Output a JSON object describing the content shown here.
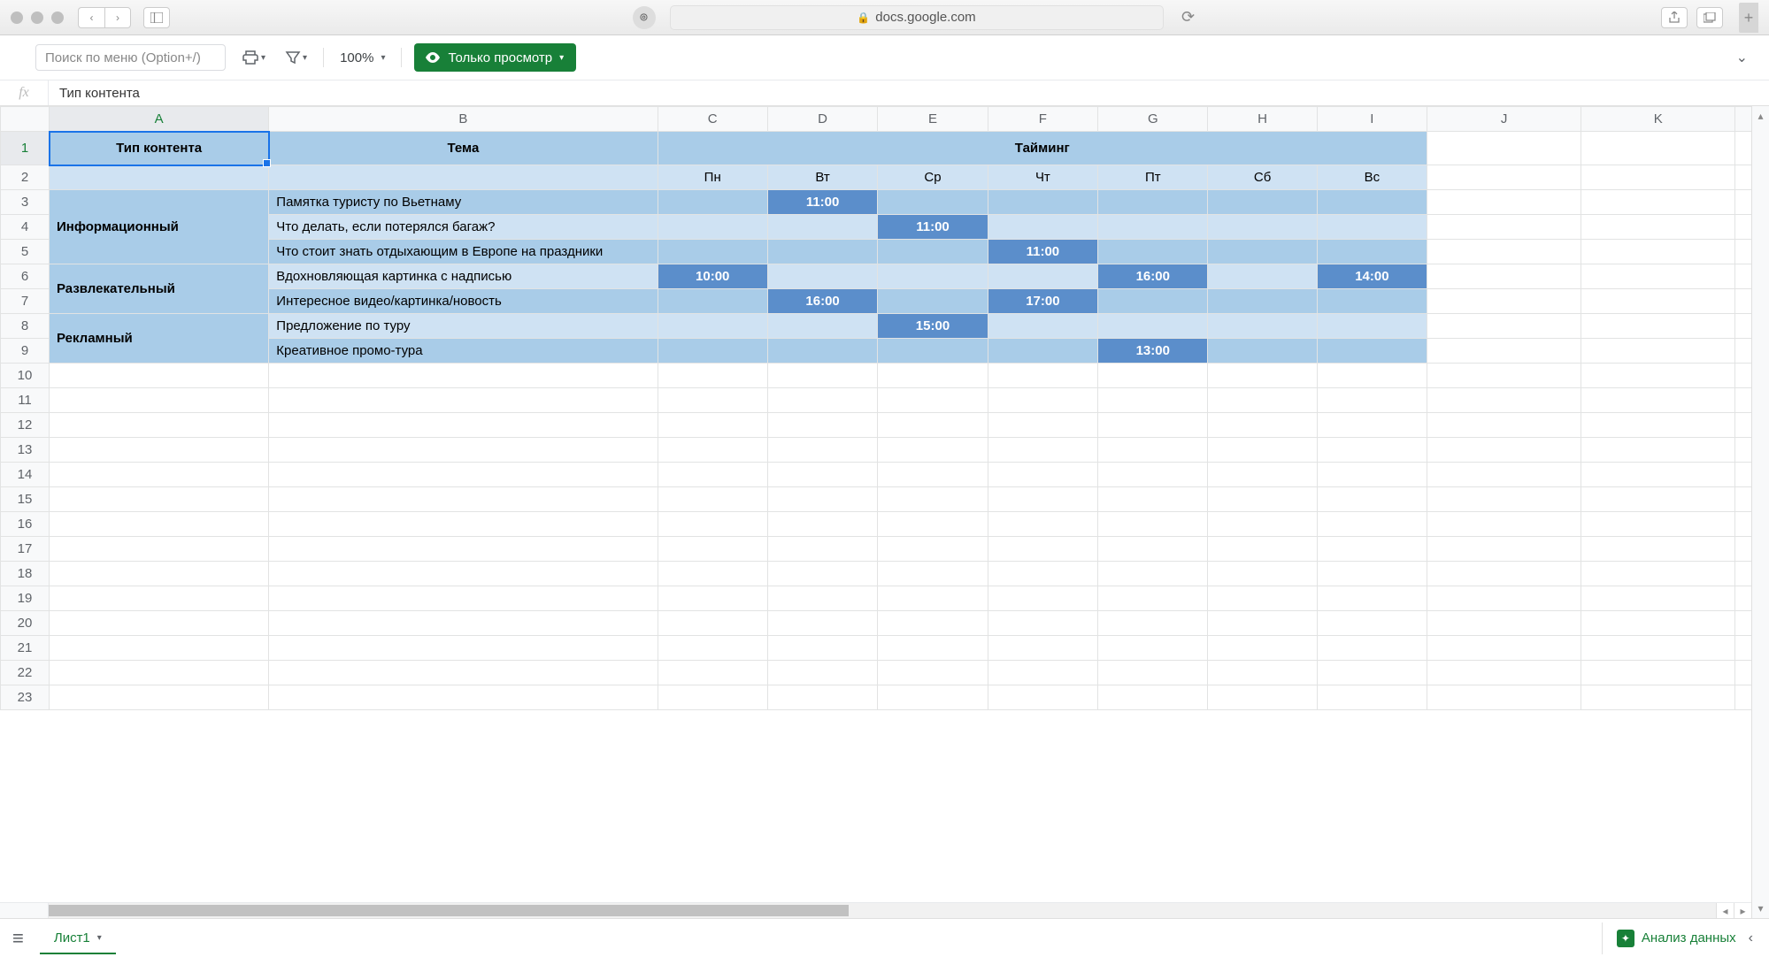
{
  "browser": {
    "url_host": "docs.google.com"
  },
  "toolbar": {
    "menu_search_placeholder": "Поиск по меню (Option+/)",
    "zoom": "100%",
    "view_only_label": "Только просмотр"
  },
  "formula_bar": {
    "fx_label": "fx",
    "value": "Тип контента"
  },
  "columns": [
    "A",
    "B",
    "C",
    "D",
    "E",
    "F",
    "G",
    "H",
    "I",
    "J",
    "K"
  ],
  "row_numbers": [
    "1",
    "2",
    "3",
    "4",
    "5",
    "6",
    "7",
    "8",
    "9",
    "10",
    "11",
    "12",
    "13",
    "14",
    "15",
    "16",
    "17",
    "18",
    "19",
    "20",
    "21",
    "22",
    "23"
  ],
  "sheet": {
    "header1": {
      "type_label": "Тип контента",
      "topic_label": "Тема",
      "timing_label": "Тайминг"
    },
    "days": [
      "Пн",
      "Вт",
      "Ср",
      "Чт",
      "Пт",
      "Сб",
      "Вс"
    ],
    "rows": [
      {
        "category": "Информационный",
        "topic": "Памятка туристу по Вьетнаму",
        "slots": [
          "",
          "11:00",
          "",
          "",
          "",
          "",
          ""
        ]
      },
      {
        "category": "",
        "topic": "Что делать, если потерялся багаж?",
        "slots": [
          "",
          "",
          "11:00",
          "",
          "",
          "",
          ""
        ]
      },
      {
        "category": "",
        "topic": "Что стоит знать отдыхающим в Европе на праздники",
        "slots": [
          "",
          "",
          "",
          "11:00",
          "",
          "",
          ""
        ]
      },
      {
        "category": "Развлекательный",
        "topic": "Вдохновляющая картинка с надписью",
        "slots": [
          "10:00",
          "",
          "",
          "",
          "16:00",
          "",
          "14:00"
        ]
      },
      {
        "category": "",
        "topic": "Интересное видео/картинка/новость",
        "slots": [
          "",
          "16:00",
          "",
          "17:00",
          "",
          "",
          ""
        ]
      },
      {
        "category": "Рекламный",
        "topic": "Предложение по туру",
        "slots": [
          "",
          "",
          "15:00",
          "",
          "",
          "",
          ""
        ]
      },
      {
        "category": "",
        "topic": "Креативное промо-тура",
        "slots": [
          "",
          "",
          "",
          "",
          "13:00",
          "",
          ""
        ]
      }
    ]
  },
  "footer": {
    "sheet_name": "Лист1",
    "analyze_label": "Анализ данных"
  }
}
